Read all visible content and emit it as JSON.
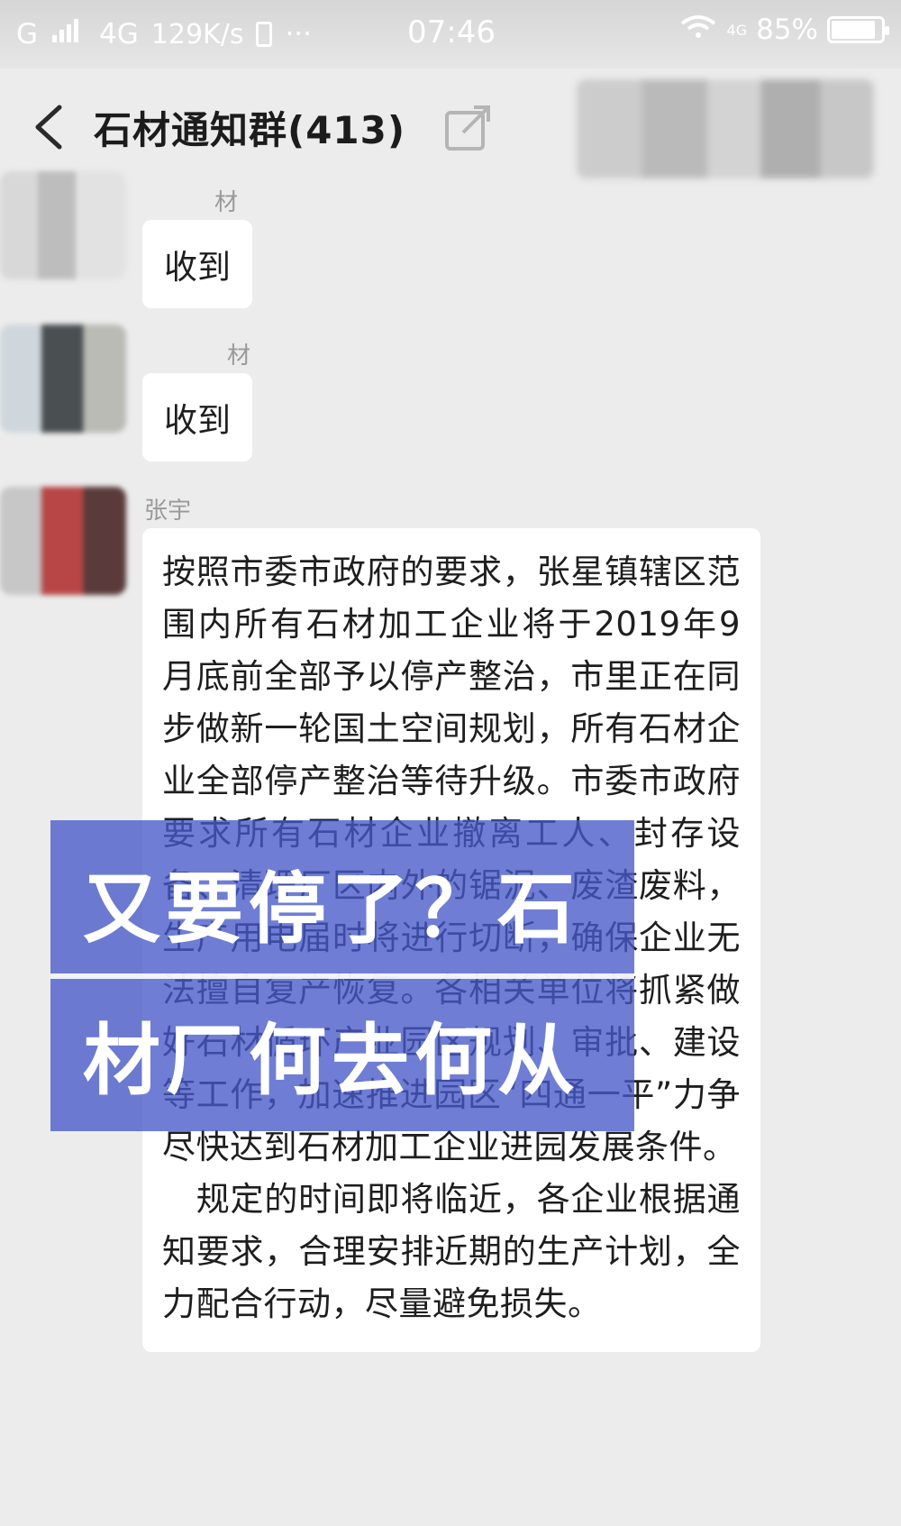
{
  "status_bar": {
    "carrier_left": "G",
    "network": "4G",
    "speed": "129K/s",
    "speed_unit": "KB/s",
    "more": "···",
    "time": "07:46",
    "network_right": "4G",
    "battery": "85%"
  },
  "header": {
    "title": "石材通知群(413)"
  },
  "messages": [
    {
      "sender": "材",
      "text": "收到"
    },
    {
      "sender": "材",
      "text": "收到"
    },
    {
      "sender": "张宇",
      "text": "按照市委市政府的要求，张星镇辖区范围内所有石材加工企业将于2019年9月底前全部予以停产整治，市里正在同步做新一轮国土空间规划，所有石材企业全部停产整治等待升级。市委市政府要求所有石材企业撤离工人、封存设备、清理厂区内外的锯泥、废渣废料，生产用电届时将进行切断，确保企业无法擅自复产恢复。各相关单位将抓紧做好石材循环产业园区规划、审批、建设等工作，加速推进园区“四通一平”力争尽快达到石材加工企业进园发展条件。\n　规定的时间即将临近，各企业根据通知要求，合理安排近期的生产计划，全力配合行动，尽量避免损失。"
    }
  ],
  "overlay": {
    "line1": "又要停了？石",
    "line2": "材厂何去何从"
  },
  "colors": {
    "background": "#ececec",
    "bubble": "#ffffff",
    "overlay": "#465ac8"
  }
}
